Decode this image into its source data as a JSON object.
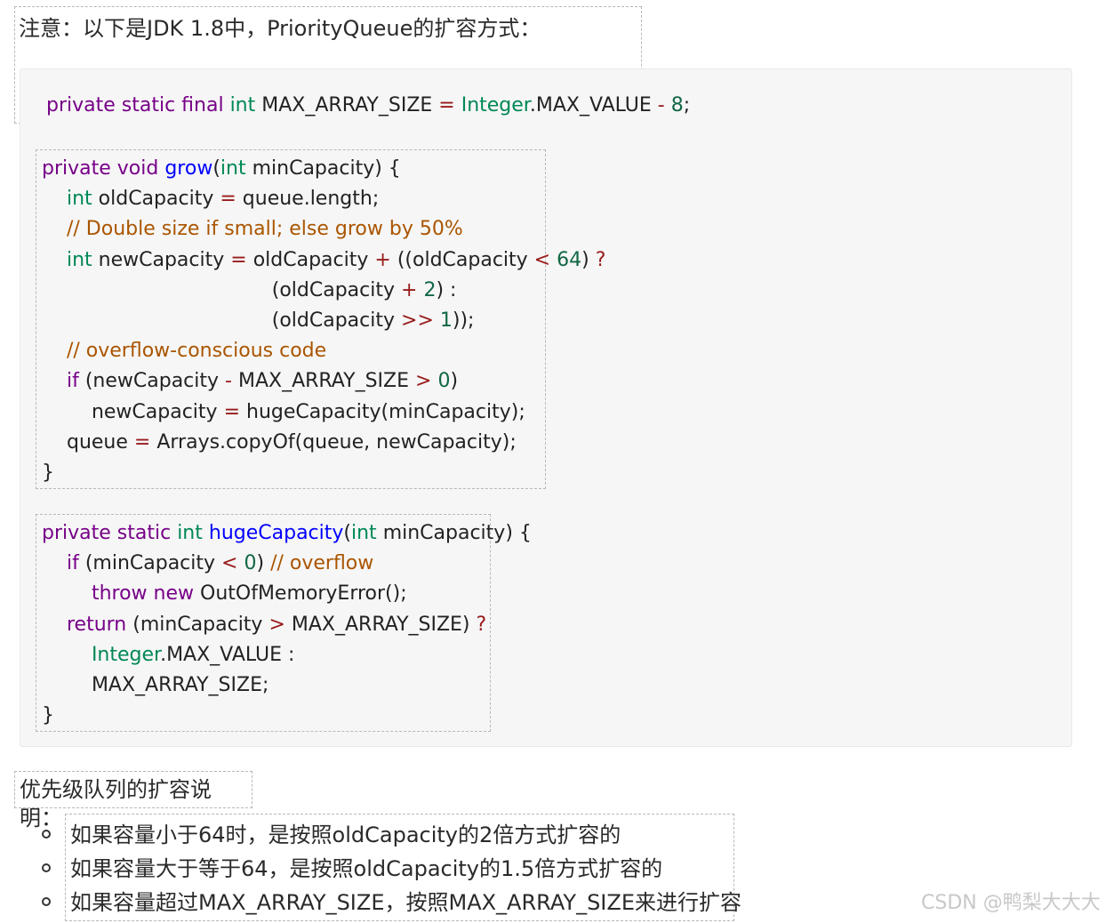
{
  "note_heading": "注意：以下是JDK 1.8中，PriorityQueue的扩容方式：",
  "code_top_line": [
    {
      "t": "private static final ",
      "c": "kw"
    },
    {
      "t": "int ",
      "c": "ty"
    },
    {
      "t": "MAX_ARRAY_SIZE ",
      "c": "pl"
    },
    {
      "t": "= ",
      "c": "op"
    },
    {
      "t": "Integer",
      "c": "ty"
    },
    {
      "t": ".MAX_VALUE ",
      "c": "pl"
    },
    {
      "t": "- ",
      "c": "op"
    },
    {
      "t": "8",
      "c": "nm"
    },
    {
      "t": ";",
      "c": "pl"
    }
  ],
  "grow_block": [
    [
      {
        "t": "private void ",
        "c": "kw"
      },
      {
        "t": "grow",
        "c": "fn"
      },
      {
        "t": "(",
        "c": "pl"
      },
      {
        "t": "int ",
        "c": "ty"
      },
      {
        "t": "minCapacity) {",
        "c": "pl"
      }
    ],
    [
      {
        "t": "    int ",
        "c": "ty"
      },
      {
        "t": "oldCapacity ",
        "c": "pl"
      },
      {
        "t": "= ",
        "c": "op"
      },
      {
        "t": "queue.length;",
        "c": "pl"
      }
    ],
    [
      {
        "t": "    // Double size if small; else grow by 50%",
        "c": "cm"
      }
    ],
    [
      {
        "t": "    int ",
        "c": "ty"
      },
      {
        "t": "newCapacity ",
        "c": "pl"
      },
      {
        "t": "= ",
        "c": "op"
      },
      {
        "t": "oldCapacity ",
        "c": "pl"
      },
      {
        "t": "+ ",
        "c": "op"
      },
      {
        "t": "((oldCapacity ",
        "c": "pl"
      },
      {
        "t": "< ",
        "c": "op"
      },
      {
        "t": "64",
        "c": "nm"
      },
      {
        "t": ") ",
        "c": "pl"
      },
      {
        "t": "?",
        "c": "op"
      }
    ],
    [
      {
        "t": "                                     (oldCapacity ",
        "c": "pl"
      },
      {
        "t": "+ ",
        "c": "op"
      },
      {
        "t": "2",
        "c": "nm"
      },
      {
        "t": ") :",
        "c": "pl"
      }
    ],
    [
      {
        "t": "                                     (oldCapacity ",
        "c": "pl"
      },
      {
        "t": ">> ",
        "c": "op"
      },
      {
        "t": "1",
        "c": "nm"
      },
      {
        "t": "));",
        "c": "pl"
      }
    ],
    [
      {
        "t": "    // overflow-conscious code",
        "c": "cm"
      }
    ],
    [
      {
        "t": "    if ",
        "c": "kw"
      },
      {
        "t": "(newCapacity ",
        "c": "pl"
      },
      {
        "t": "- ",
        "c": "op"
      },
      {
        "t": "MAX_ARRAY_SIZE ",
        "c": "pl"
      },
      {
        "t": "> ",
        "c": "op"
      },
      {
        "t": "0",
        "c": "nm"
      },
      {
        "t": ")",
        "c": "pl"
      }
    ],
    [
      {
        "t": "        newCapacity ",
        "c": "pl"
      },
      {
        "t": "= ",
        "c": "op"
      },
      {
        "t": "hugeCapacity(minCapacity);",
        "c": "pl"
      }
    ],
    [
      {
        "t": "    queue ",
        "c": "pl"
      },
      {
        "t": "= ",
        "c": "op"
      },
      {
        "t": "Arrays.copyOf(queue, newCapacity);",
        "c": "pl"
      }
    ],
    [
      {
        "t": "}",
        "c": "pl"
      }
    ]
  ],
  "huge_block": [
    [
      {
        "t": "private static ",
        "c": "kw"
      },
      {
        "t": "int ",
        "c": "ty"
      },
      {
        "t": "hugeCapacity",
        "c": "fn"
      },
      {
        "t": "(",
        "c": "pl"
      },
      {
        "t": "int ",
        "c": "ty"
      },
      {
        "t": "minCapacity) {",
        "c": "pl"
      }
    ],
    [
      {
        "t": "    if ",
        "c": "kw"
      },
      {
        "t": "(minCapacity ",
        "c": "pl"
      },
      {
        "t": "< ",
        "c": "op"
      },
      {
        "t": "0",
        "c": "nm"
      },
      {
        "t": ") ",
        "c": "pl"
      },
      {
        "t": "// overflow",
        "c": "cm"
      }
    ],
    [
      {
        "t": "        throw new ",
        "c": "kw"
      },
      {
        "t": "OutOfMemoryError();",
        "c": "pl"
      }
    ],
    [
      {
        "t": "    return ",
        "c": "kw"
      },
      {
        "t": "(minCapacity ",
        "c": "pl"
      },
      {
        "t": "> ",
        "c": "op"
      },
      {
        "t": "MAX_ARRAY_SIZE) ",
        "c": "pl"
      },
      {
        "t": "?",
        "c": "op"
      }
    ],
    [
      {
        "t": "        Integer",
        "c": "ty"
      },
      {
        "t": ".MAX_VALUE :",
        "c": "pl"
      }
    ],
    [
      {
        "t": "        MAX_ARRAY_SIZE;",
        "c": "pl"
      }
    ],
    [
      {
        "t": "}",
        "c": "pl"
      }
    ]
  ],
  "section_heading": "优先级队列的扩容说明：",
  "bullets": [
    "如果容量小于64时，是按照oldCapacity的2倍方式扩容的",
    "如果容量大于等于64，是按照oldCapacity的1.5倍方式扩容的",
    "如果容量超过MAX_ARRAY_SIZE，按照MAX_ARRAY_SIZE来进行扩容"
  ],
  "watermark": "CSDN @鸭梨大大大"
}
